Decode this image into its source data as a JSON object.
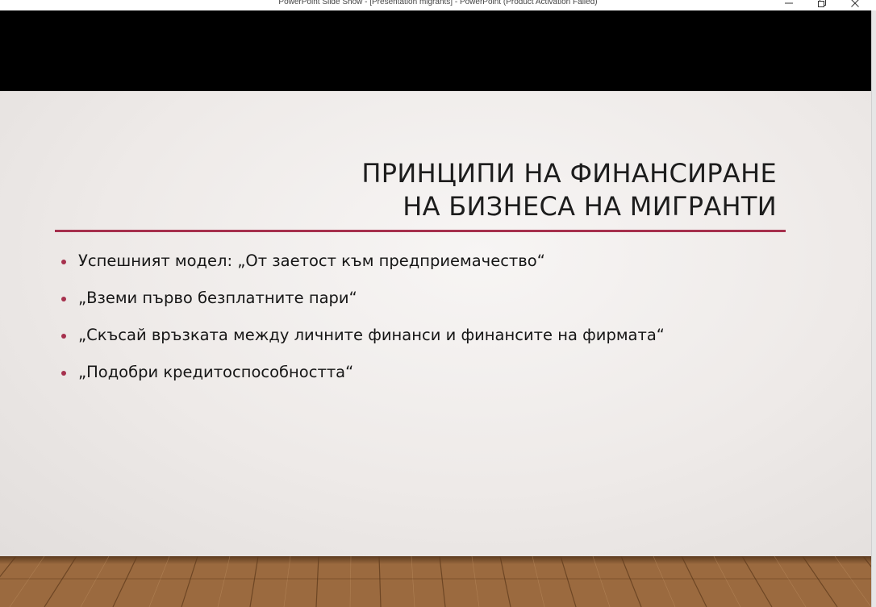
{
  "window": {
    "title": "PowerPoint Slide Show - [Presentation migrants] - PowerPoint (Product Activation Failed)",
    "minimize_icon": "minimize-icon",
    "restore_icon": "restore-icon",
    "close_icon": "close-icon"
  },
  "slide": {
    "title_line1": "ПРИНЦИПИ НА ФИНАНСИРАНЕ",
    "title_line2": "НА БИЗНЕСА НА МИГРАНТИ",
    "bullets": [
      "Успешният модел: „От заетост към предприемачество“",
      "„Вземи първо безплатните пари“",
      "„Скъсай връзката между личните финанси и финансите на фирмата“",
      "„Подобри кредитоспособността“"
    ]
  },
  "colors": {
    "accent": "#a6304d",
    "band": "#000000",
    "floor": "#9b6a3f"
  }
}
